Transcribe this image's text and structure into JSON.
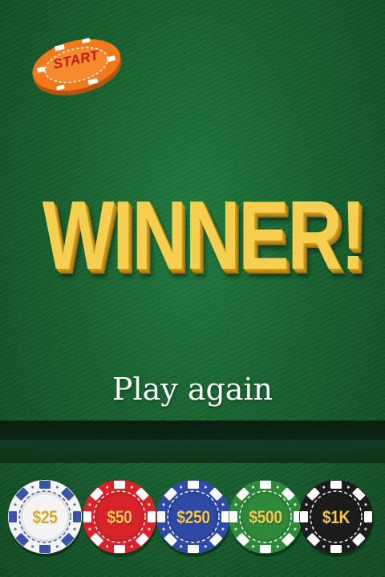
{
  "start_chip": {
    "label": "START",
    "color": "#f07a1c"
  },
  "headline": "WINNER!",
  "play_again": "Play again",
  "chips": [
    {
      "label": "$25",
      "color": "#f4f4f4",
      "stripe": "#3a53a8"
    },
    {
      "label": "$50",
      "color": "#d8232a",
      "stripe": "#ffffff"
    },
    {
      "label": "$250",
      "color": "#2e4aa6",
      "stripe": "#ffffff"
    },
    {
      "label": "$500",
      "color": "#2e8a3a",
      "stripe": "#ffffff"
    },
    {
      "label": "$1K",
      "color": "#1c1c1c",
      "stripe": "#ffffff"
    }
  ],
  "colors": {
    "felt": "#1a6b34",
    "headline": "#f6cf4f"
  }
}
